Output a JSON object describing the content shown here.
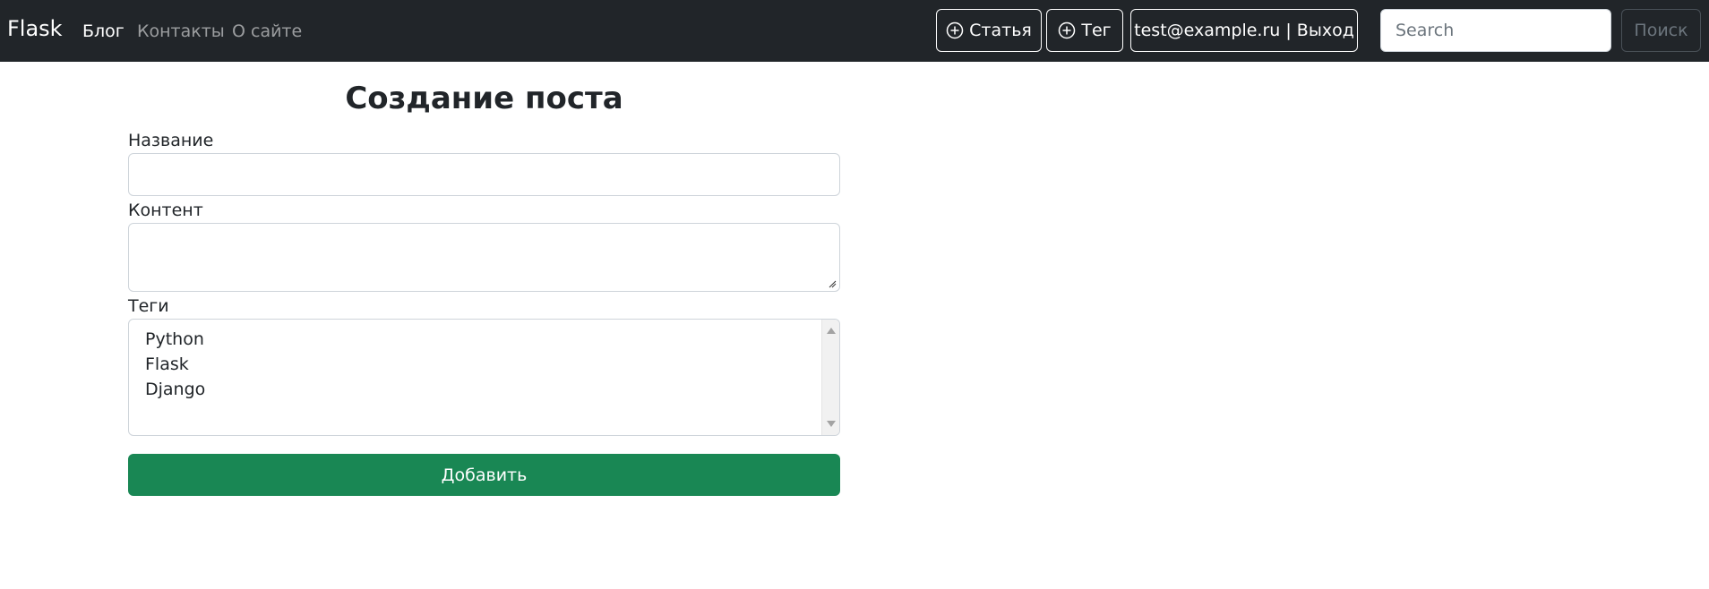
{
  "navbar": {
    "brand": "Flask",
    "links": [
      {
        "label": "Блог",
        "active": true
      },
      {
        "label": "Контакты",
        "active": false
      },
      {
        "label": "О сайте",
        "active": false
      }
    ],
    "add_article_label": "Статья",
    "add_tag_label": "Тег",
    "user_label": "test@example.ru | Выход",
    "search": {
      "placeholder": "Search",
      "value": ""
    },
    "search_button_label": "Поиск",
    "icons": {
      "add": "plus-circle-icon"
    }
  },
  "form": {
    "title": "Создание поста",
    "name_label": "Название",
    "name_value": "",
    "content_label": "Контент",
    "content_value": "",
    "tags_label": "Теги",
    "tags_options": [
      "Python",
      "Flask",
      "Django"
    ],
    "submit_label": "Добавить"
  },
  "colors": {
    "navbar_bg": "#212529",
    "submit_bg": "#198754"
  }
}
